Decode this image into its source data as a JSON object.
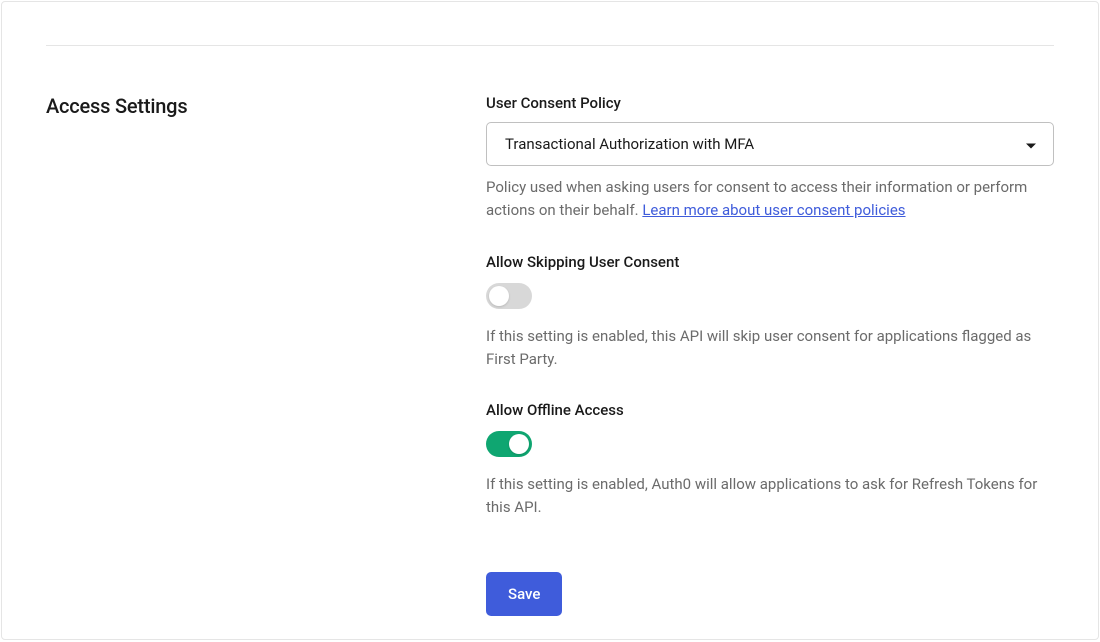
{
  "section": {
    "title": "Access Settings"
  },
  "consent_policy": {
    "label": "User Consent Policy",
    "selected": "Transactional Authorization with MFA",
    "help_text_prefix": "Policy used when asking users for consent to access their information or perform actions on their behalf. ",
    "help_link_text": "Learn more about user consent policies"
  },
  "skip_consent": {
    "label": "Allow Skipping User Consent",
    "enabled": false,
    "help_text": "If this setting is enabled, this API will skip user consent for applications flagged as First Party."
  },
  "offline_access": {
    "label": "Allow Offline Access",
    "enabled": true,
    "help_text": "If this setting is enabled, Auth0 will allow applications to ask for Refresh Tokens for this API."
  },
  "actions": {
    "save_label": "Save"
  }
}
